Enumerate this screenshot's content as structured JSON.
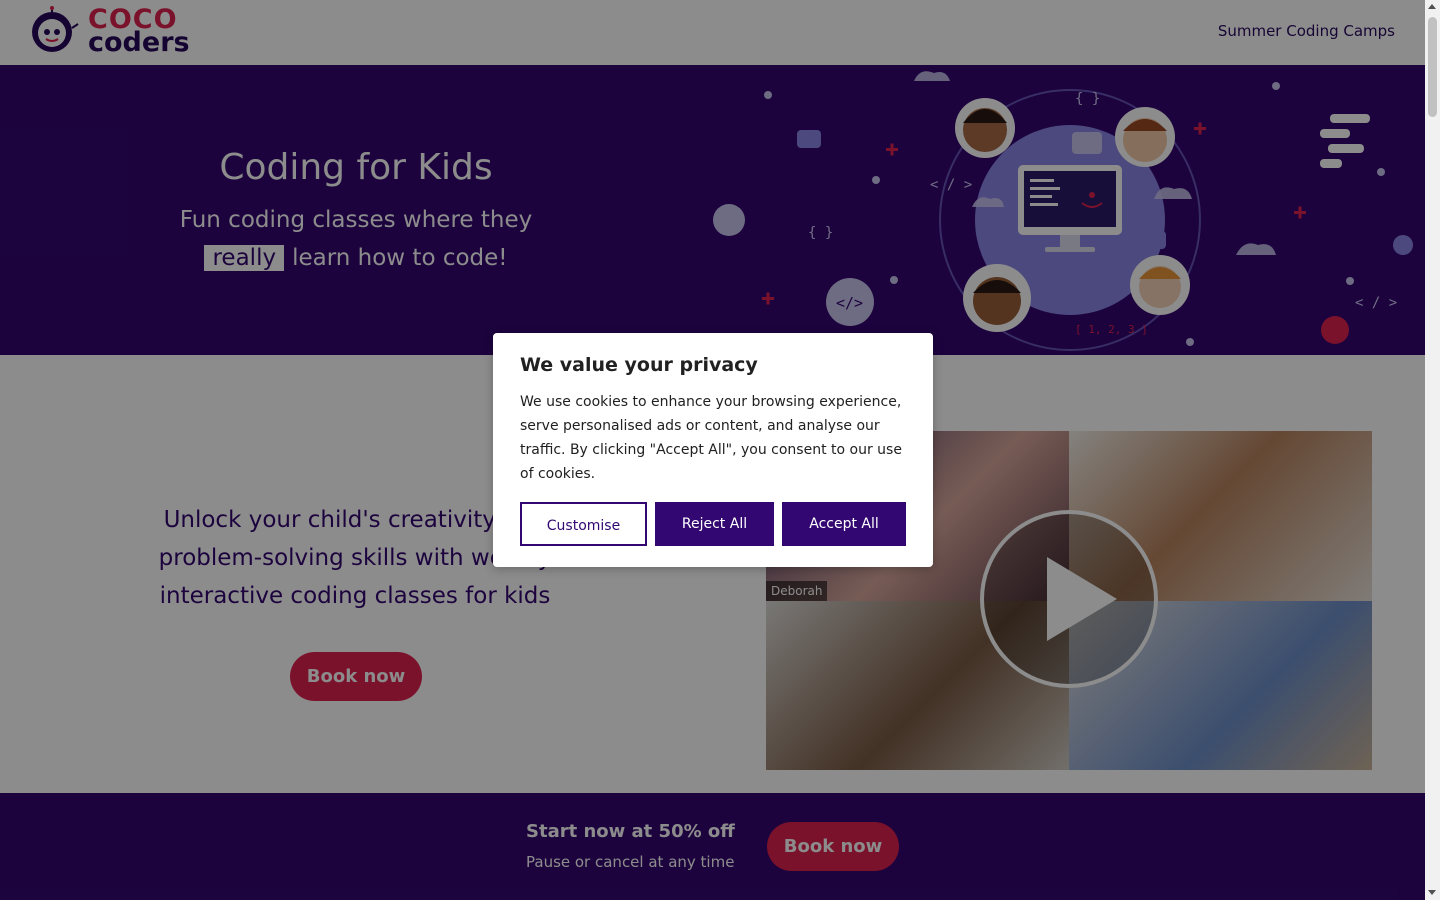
{
  "header": {
    "logo_line1": "COCO",
    "logo_line2": "coders",
    "nav_link": "Summer Coding Camps"
  },
  "hero": {
    "title": "Coding for Kids",
    "subtitle_pre": "Fun coding classes where they",
    "highlight": "really",
    "subtitle_post": "learn how to code!"
  },
  "main": {
    "pitch": "Unlock your child's creativity and problem-solving skills with weekly interactive coding classes for kids",
    "cta_label": "Book now",
    "video": {
      "participant_name": "Deborah"
    }
  },
  "banner": {
    "title": "Start now at 50% off",
    "subtitle": "Pause or cancel at any time",
    "cta_label": "Book now"
  },
  "cookie_dialog": {
    "title": "We value your privacy",
    "body": "We use cookies to enhance your browsing experience, serve personalised ads or content, and analyse our traffic. By clicking \"Accept All\", you consent to our use of cookies.",
    "customise_label": "Customise",
    "reject_label": "Reject All",
    "accept_label": "Accept All"
  },
  "colors": {
    "brand_purple": "#330771",
    "brand_red": "#e0214f"
  }
}
